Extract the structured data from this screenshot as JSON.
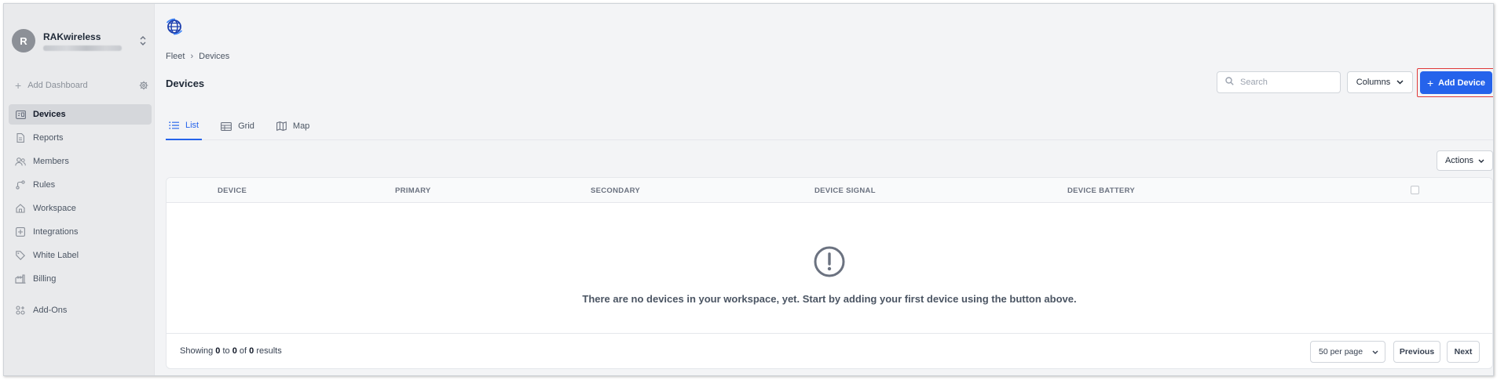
{
  "sidebar": {
    "account": {
      "initial": "R",
      "name": "RAKwireless"
    },
    "add_dashboard_label": "Add Dashboard",
    "items": [
      {
        "label": "Devices",
        "icon": "devices-icon",
        "active": true
      },
      {
        "label": "Reports",
        "icon": "reports-icon"
      },
      {
        "label": "Members",
        "icon": "members-icon"
      },
      {
        "label": "Rules",
        "icon": "rules-icon"
      },
      {
        "label": "Workspace",
        "icon": "workspace-icon"
      },
      {
        "label": "Integrations",
        "icon": "integrations-icon"
      },
      {
        "label": "White Label",
        "icon": "tag-icon"
      },
      {
        "label": "Billing",
        "icon": "billing-icon"
      },
      {
        "label": "Add-Ons",
        "icon": "add-ons-icon"
      }
    ]
  },
  "header": {
    "breadcrumb": [
      "Fleet",
      "Devices"
    ],
    "title": "Devices",
    "search_placeholder": "Search",
    "columns_label": "Columns",
    "add_device_label": "Add Device"
  },
  "tabs": [
    {
      "label": "List",
      "icon": "list-icon",
      "active": true
    },
    {
      "label": "Grid",
      "icon": "grid-icon"
    },
    {
      "label": "Map",
      "icon": "map-icon"
    }
  ],
  "actions_label": "Actions",
  "table": {
    "columns": [
      "DEVICE",
      "PRIMARY",
      "SECONDARY",
      "DEVICE SIGNAL",
      "DEVICE BATTERY"
    ],
    "empty_message": "There are no devices in your workspace, yet. Start by adding your first device using the button above."
  },
  "footer": {
    "showing_prefix": "Showing",
    "from": "0",
    "to_word": "to",
    "to": "0",
    "of_word": "of",
    "total": "0",
    "results_word": "results",
    "per_page": "50 per page",
    "previous_label": "Previous",
    "next_label": "Next"
  },
  "colors": {
    "accent": "#2563eb",
    "highlight_border": "#e03a3a",
    "sidebar_bg": "#e9eaec",
    "main_bg": "#f3f4f6"
  }
}
